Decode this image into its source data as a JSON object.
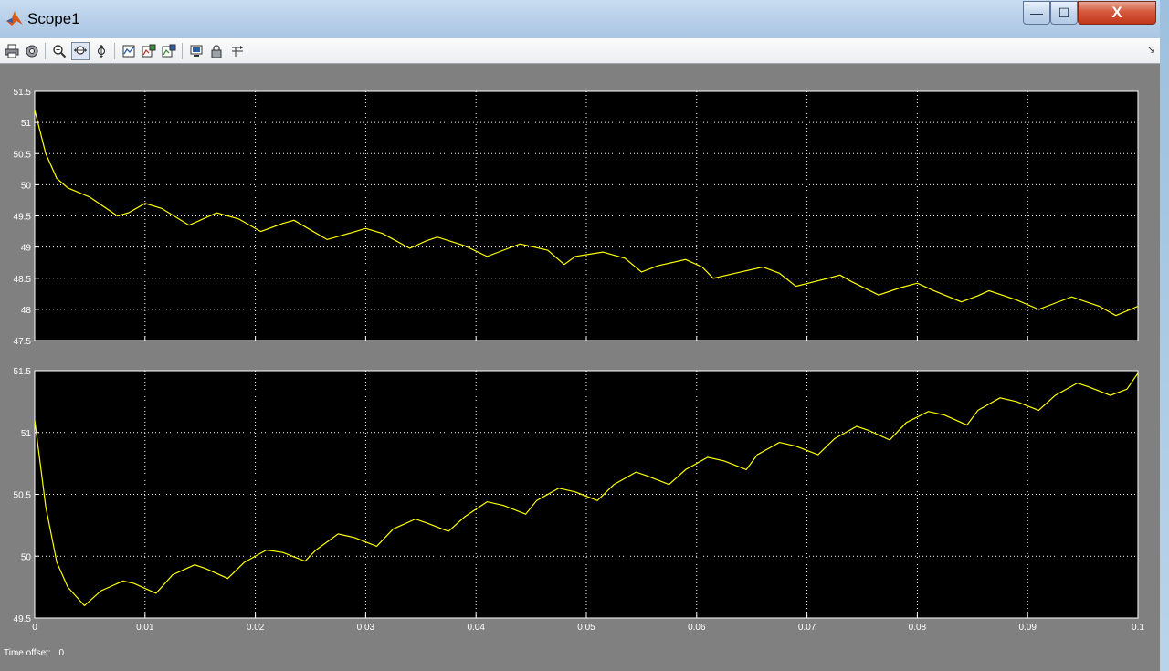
{
  "window": {
    "title": "Scope1",
    "close_glyph": "X",
    "min_glyph": "—",
    "max_glyph": "☐"
  },
  "toolbar": {
    "items": [
      {
        "icon": "print-icon"
      },
      {
        "icon": "parameters-icon"
      },
      {
        "icon": "zoom-icon"
      },
      {
        "icon": "zoom-x-icon",
        "active": true
      },
      {
        "icon": "zoom-y-icon"
      },
      {
        "icon": "autoscale-icon"
      },
      {
        "icon": "save-axes-icon"
      },
      {
        "icon": "restore-axes-icon"
      },
      {
        "icon": "floating-scope-icon"
      },
      {
        "icon": "lock-axes-icon"
      },
      {
        "icon": "signal-selection-icon"
      }
    ],
    "dock_glyph": "↘"
  },
  "colors": {
    "plot_bg": "#000000",
    "trace": "#ffff00",
    "figure_bg": "#808080"
  },
  "chart_data": [
    {
      "type": "line",
      "xlim": [
        0,
        0.1
      ],
      "ylim": [
        47.5,
        51.5
      ],
      "xticks": [
        "0",
        "0.01",
        "0.02",
        "0.03",
        "0.04",
        "0.05",
        "0.06",
        "0.07",
        "0.08",
        "0.09",
        "0.1"
      ],
      "yticks": [
        "47.5",
        "48",
        "48.5",
        "49",
        "49.5",
        "50",
        "50.5",
        "51",
        "51.5"
      ],
      "grid": true,
      "x": [
        0,
        0.001,
        0.002,
        0.003,
        0.005,
        0.0075,
        0.0085,
        0.01,
        0.0115,
        0.014,
        0.0165,
        0.0185,
        0.0205,
        0.0225,
        0.0235,
        0.0265,
        0.0285,
        0.03,
        0.0315,
        0.034,
        0.0355,
        0.0365,
        0.039,
        0.041,
        0.0425,
        0.044,
        0.0465,
        0.048,
        0.049,
        0.0515,
        0.0535,
        0.055,
        0.0565,
        0.059,
        0.0605,
        0.0615,
        0.064,
        0.066,
        0.0675,
        0.069,
        0.0715,
        0.073,
        0.074,
        0.0765,
        0.0785,
        0.08,
        0.0815,
        0.084,
        0.0855,
        0.0865,
        0.089,
        0.091,
        0.0925,
        0.094,
        0.0965,
        0.098,
        0.1
      ],
      "y": [
        51.2,
        50.5,
        50.1,
        49.95,
        49.8,
        49.5,
        49.55,
        49.7,
        49.62,
        49.35,
        49.55,
        49.45,
        49.25,
        49.38,
        49.43,
        49.12,
        49.22,
        49.3,
        49.22,
        48.98,
        49.1,
        49.16,
        49.02,
        48.85,
        48.95,
        49.05,
        48.95,
        48.72,
        48.85,
        48.92,
        48.82,
        48.6,
        48.7,
        48.8,
        48.68,
        48.5,
        48.6,
        48.68,
        48.58,
        48.37,
        48.48,
        48.55,
        48.45,
        48.23,
        48.35,
        48.42,
        48.3,
        48.12,
        48.22,
        48.3,
        48.15,
        48.0,
        48.1,
        48.2,
        48.05,
        47.9,
        48.05,
        48.08,
        47.8
      ]
    },
    {
      "type": "line",
      "xlim": [
        0,
        0.1
      ],
      "ylim": [
        49.5,
        51.5
      ],
      "xticks": [
        "0",
        "0.01",
        "0.02",
        "0.03",
        "0.04",
        "0.05",
        "0.06",
        "0.07",
        "0.08",
        "0.09",
        "0.1"
      ],
      "yticks": [
        "49.5",
        "50",
        "50.5",
        "51",
        "51.5"
      ],
      "grid": true,
      "x": [
        0,
        0.001,
        0.002,
        0.003,
        0.0045,
        0.006,
        0.008,
        0.009,
        0.011,
        0.0125,
        0.0145,
        0.0155,
        0.0175,
        0.019,
        0.021,
        0.0225,
        0.0245,
        0.0255,
        0.0275,
        0.029,
        0.031,
        0.0325,
        0.0345,
        0.0355,
        0.0375,
        0.039,
        0.041,
        0.0425,
        0.0445,
        0.0455,
        0.0475,
        0.049,
        0.051,
        0.0525,
        0.0545,
        0.0555,
        0.0575,
        0.059,
        0.061,
        0.0625,
        0.0645,
        0.0655,
        0.0675,
        0.069,
        0.071,
        0.0725,
        0.0745,
        0.0755,
        0.0775,
        0.079,
        0.081,
        0.0825,
        0.0845,
        0.0855,
        0.0875,
        0.089,
        0.091,
        0.0925,
        0.0945,
        0.0955,
        0.0975,
        0.099,
        0.1
      ],
      "y": [
        51.1,
        50.4,
        49.95,
        49.75,
        49.6,
        49.72,
        49.8,
        49.78,
        49.7,
        49.85,
        49.93,
        49.9,
        49.82,
        49.95,
        50.05,
        50.03,
        49.96,
        50.05,
        50.18,
        50.15,
        50.08,
        50.22,
        50.3,
        50.27,
        50.2,
        50.32,
        50.44,
        50.41,
        50.34,
        50.45,
        50.55,
        50.52,
        50.45,
        50.58,
        50.68,
        50.65,
        50.58,
        50.7,
        50.8,
        50.77,
        50.7,
        50.82,
        50.92,
        50.89,
        50.82,
        50.95,
        51.05,
        51.02,
        50.94,
        51.08,
        51.17,
        51.14,
        51.06,
        51.18,
        51.28,
        51.25,
        51.18,
        51.3,
        51.4,
        51.37,
        51.3,
        51.35,
        51.48
      ]
    }
  ],
  "footer": {
    "time_offset_label": "Time offset:",
    "time_offset_value": "0"
  }
}
